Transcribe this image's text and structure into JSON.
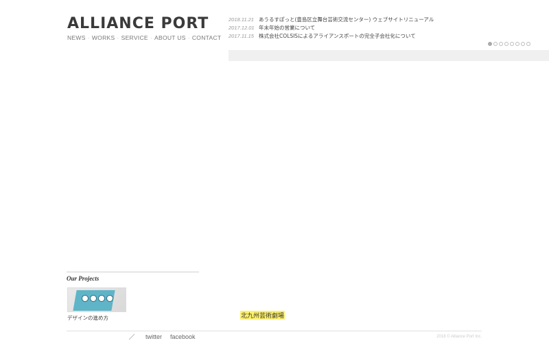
{
  "header": {
    "logo_text": "ALLIANCE PORT",
    "nav": [
      {
        "label": "NEWS"
      },
      {
        "label": "WORKS"
      },
      {
        "label": "SERVICE"
      },
      {
        "label": "ABOUT US"
      },
      {
        "label": "CONTACT"
      }
    ]
  },
  "news": [
    {
      "date": "2018.11.21",
      "title": "あうるすぽっと(豊島区立舞台芸術交流センター) ウェブサイトリニューアル"
    },
    {
      "date": "2017.12.01",
      "title": "年末年始の営業について"
    },
    {
      "date": "2017.11.15",
      "title": "株式会社COLSISによるアライアンスポートの完全子会社化について"
    }
  ],
  "slider": {
    "dot_count": 8,
    "active_index": 0
  },
  "projects": {
    "title": "Our Projects",
    "items": [
      {
        "caption": "デザインの進め方"
      }
    ]
  },
  "highlight": {
    "label": "北九州芸術劇場"
  },
  "footer": {
    "links": [
      {
        "label": "twitter"
      },
      {
        "label": "facebook"
      }
    ],
    "copyright": "2018 © Alliance Port Inc."
  },
  "colors": {
    "highlight": "#fff16a",
    "slide_bar": "#f0f0f0",
    "dot_active": "#aaaaaa"
  }
}
